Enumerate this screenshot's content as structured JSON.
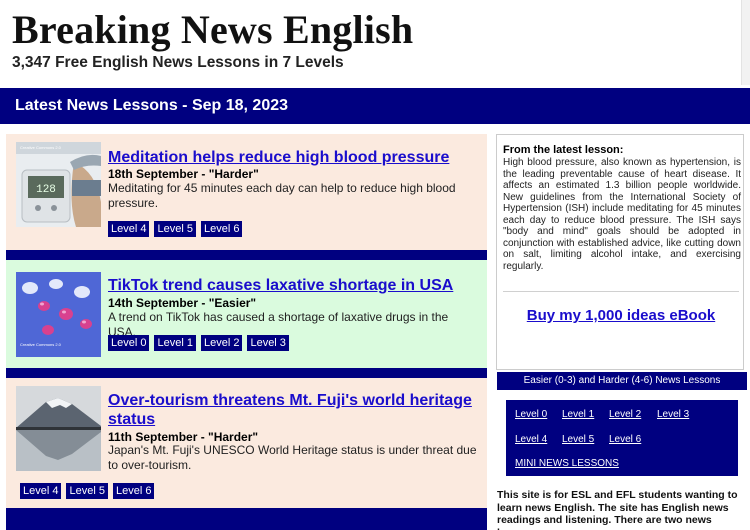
{
  "site": {
    "title": "Breaking News English",
    "subtitle": "3,347 Free English News Lessons in 7 Levels"
  },
  "banner": {
    "text": "Latest News Lessons  -  Sep 18, 2023"
  },
  "lessons": [
    {
      "title": "Meditation helps reduce high blood pressure",
      "date": "18th September - \"Harder\"",
      "description": "Meditating for 45 minutes each day can help to reduce high blood pressure.",
      "thumb_caption": "Creative Commons 2.0",
      "levels": [
        "Level 4",
        "Level 5",
        "Level 6"
      ]
    },
    {
      "title": "TikTok trend causes laxative shortage in USA",
      "date": "14th September - \"Easier\"",
      "description": "A trend on TikTok has caused a shortage of laxative drugs in the USA.",
      "thumb_caption": "Creative Commons 2.0",
      "levels": [
        "Level 0",
        "Level 1",
        "Level 2",
        "Level 3"
      ]
    },
    {
      "title": "Over-tourism threatens Mt. Fuji's world heritage status",
      "date": "11th September - \"Harder\"",
      "description": "Japan's Mt. Fuji's UNESCO World Heritage status is under threat due to over-tourism.",
      "levels": [
        "Level 4",
        "Level 5",
        "Level 6"
      ]
    }
  ],
  "sidebar": {
    "latest_head": "From the latest lesson",
    "latest_text": "High blood pressure, also known as hypertension, is the leading preventable cause of heart disease. It affects an estimated 1.3 billion people worldwide. New guidelines from the International Society of Hypertension (ISH) include meditating for 45 minutes each day to reduce blood pressure. The ISH says \"body and mind\" goals should be adopted in conjunction with established advice, like cutting down on salt, limiting alcohol intake, and exercising regularly.",
    "ebook_link": "Buy my 1,000 ideas eBook",
    "levels_head": "Easier (0-3)  and  Harder (4-6) News Lessons",
    "level_links": [
      "Level 0",
      "Level 1",
      "Level 2",
      "Level 3",
      "Level 4",
      "Level 5",
      "Level 6"
    ],
    "mini_link": "MINI NEWS LESSONS",
    "about": "This site is for ESL and EFL students wanting to learn news English. The site has English news readings and listening. There are two news lessons"
  },
  "colors": {
    "navy": "#000080",
    "link": "#1a0dcc",
    "peach": "#fbeadf",
    "mint": "#dafbde"
  }
}
